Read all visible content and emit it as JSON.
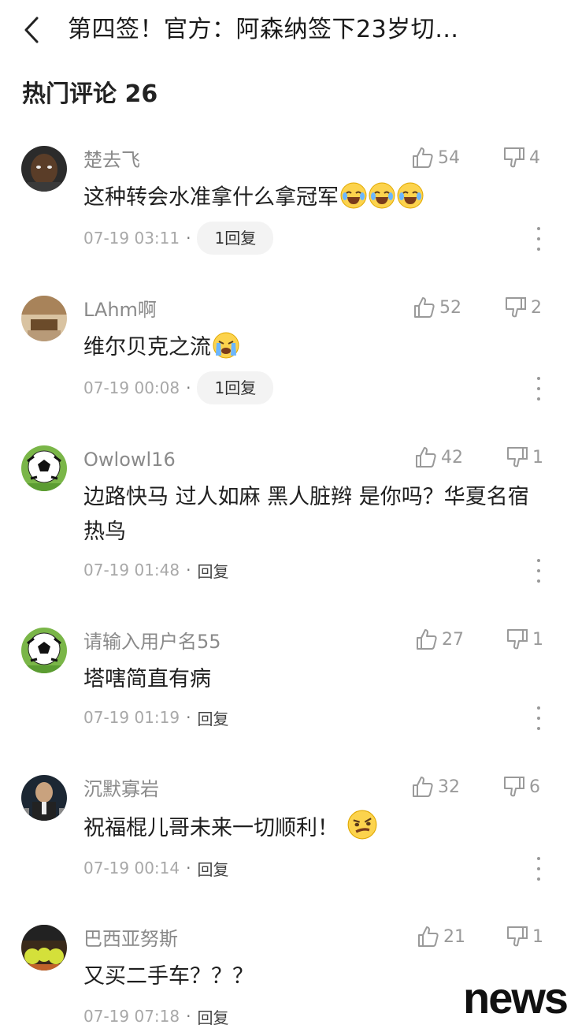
{
  "header": {
    "title": "第四签！官方：阿森纳签下23岁切…"
  },
  "section": {
    "title": "热门评论 26"
  },
  "comments": [
    {
      "user": "楚去飞",
      "text": "这种转会水准拿什么拿冠军",
      "likes": "54",
      "dislikes": "4",
      "time": "07-19 03:11",
      "reply": "1回复"
    },
    {
      "user": "LAhm啊",
      "text": "维尔贝克之流",
      "likes": "52",
      "dislikes": "2",
      "time": "07-19 00:08",
      "reply": "1回复"
    },
    {
      "user": "Owlowl16",
      "text": "边路快马 过人如麻 黑人脏辫 是你吗？华夏名宿 热鸟",
      "likes": "42",
      "dislikes": "1",
      "time": "07-19 01:48",
      "reply": "回复"
    },
    {
      "user": "请输入用户名55",
      "text": "塔嗐简直有病",
      "likes": "27",
      "dislikes": "1",
      "time": "07-19 01:19",
      "reply": "回复"
    },
    {
      "user": "沉默寡岩",
      "text": "祝福棍儿哥未来一切顺利！",
      "likes": "32",
      "dislikes": "6",
      "time": "07-19 00:14",
      "reply": "回复"
    },
    {
      "user": "巴西亚努斯",
      "text": "又买二手车？？？",
      "likes": "21",
      "dislikes": "1",
      "time": "07-19 07:18",
      "reply": "回复"
    }
  ],
  "dot": "·",
  "watermark": "news"
}
